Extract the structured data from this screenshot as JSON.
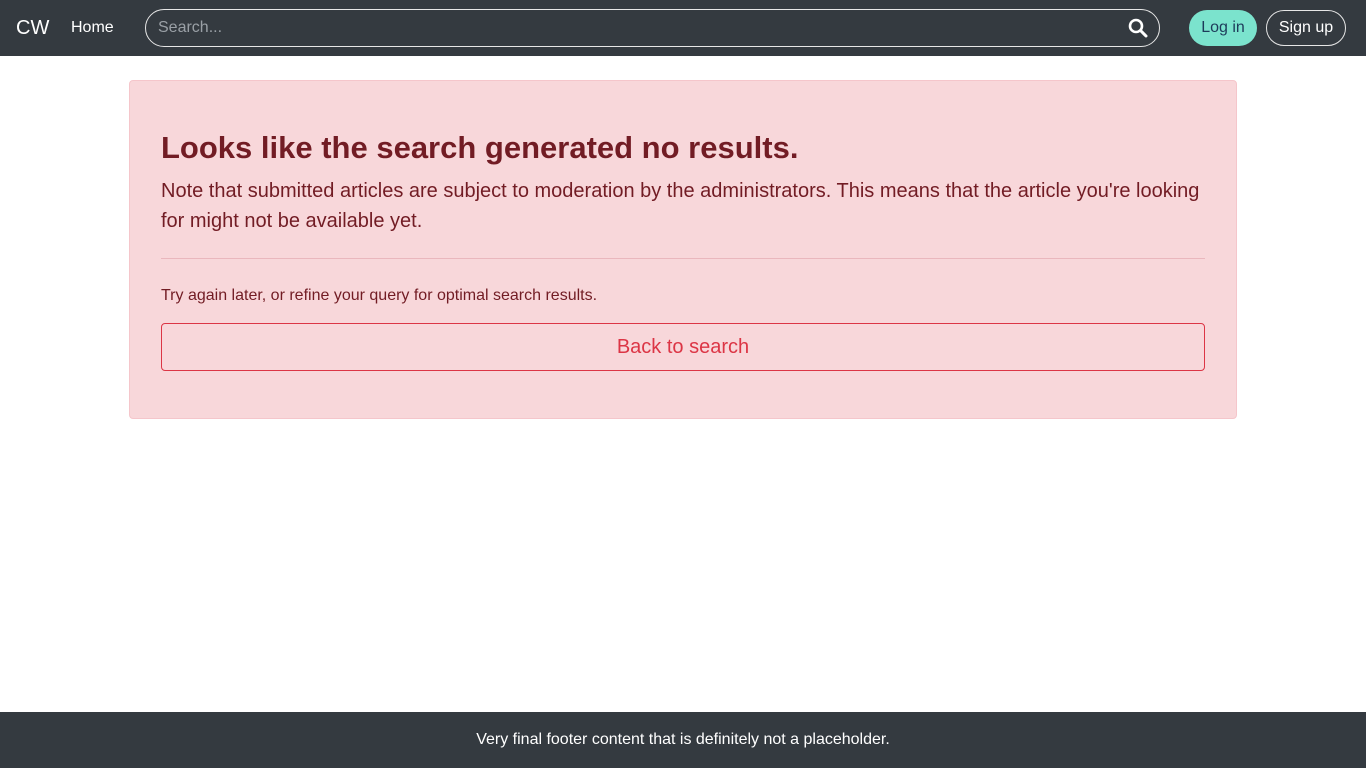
{
  "navbar": {
    "brand": "CW",
    "home_label": "Home",
    "search": {
      "placeholder": "Search...",
      "value": "",
      "icon": "search-icon"
    },
    "login_label": "Log in",
    "signup_label": "Sign up"
  },
  "alert": {
    "heading": "Looks like the search generated no results.",
    "lead": "Note that submitted articles are subject to moderation by the administrators. This means that the article you're looking for might not be available yet.",
    "note": "Try again later, or refine your query for optimal search results.",
    "back_label": "Back to search"
  },
  "footer": {
    "text": "Very final footer content that is definitely not a placeholder."
  },
  "colors": {
    "navbar": "#343a40",
    "alert_bg": "#f8d7da",
    "alert_text": "#721c24",
    "danger": "#dc3545",
    "login_bg": "#7be3cd"
  }
}
